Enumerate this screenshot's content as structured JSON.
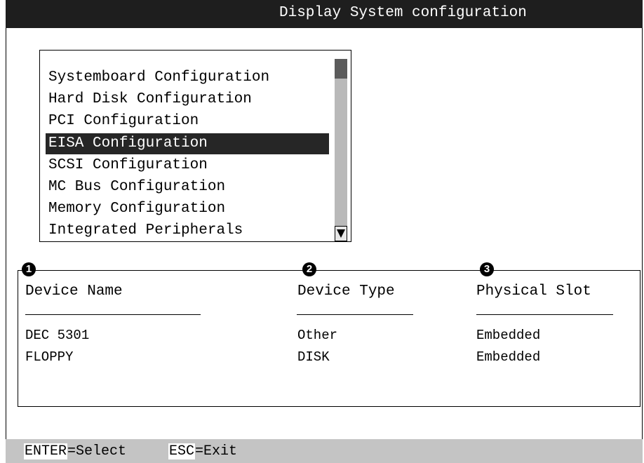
{
  "window": {
    "title": "Display System configuration"
  },
  "menu": {
    "items": [
      {
        "label": "Systemboard Configuration",
        "selected": false
      },
      {
        "label": "Hard Disk Configuration",
        "selected": false
      },
      {
        "label": "PCI Configuration",
        "selected": false
      },
      {
        "label": "EISA Configuration",
        "selected": true
      },
      {
        "label": "SCSI Configuration",
        "selected": false
      },
      {
        "label": "MC Bus Configuration",
        "selected": false
      },
      {
        "label": "Memory Configuration",
        "selected": false
      },
      {
        "label": "Integrated Peripherals",
        "selected": false
      }
    ]
  },
  "devices": {
    "callouts": [
      "1",
      "2",
      "3"
    ],
    "columns": [
      "Device Name",
      "Device Type",
      "Physical Slot"
    ],
    "rows": [
      [
        "DEC 5301",
        "Other",
        "Embedded"
      ],
      [
        "FLOPPY",
        "DISK",
        "Embedded"
      ]
    ]
  },
  "status_bar": {
    "keys": [
      {
        "key": "ENTER",
        "action": "=Select"
      },
      {
        "key": "ESC",
        "action": "=Exit"
      }
    ]
  },
  "icons": {
    "scroll_down": "triangle-down-icon"
  },
  "colors": {
    "title_bg": "#1e1e1e",
    "selection_bg": "#262626",
    "status_bg": "#c4c4c4",
    "scrollbar": "#b9b9b9"
  }
}
